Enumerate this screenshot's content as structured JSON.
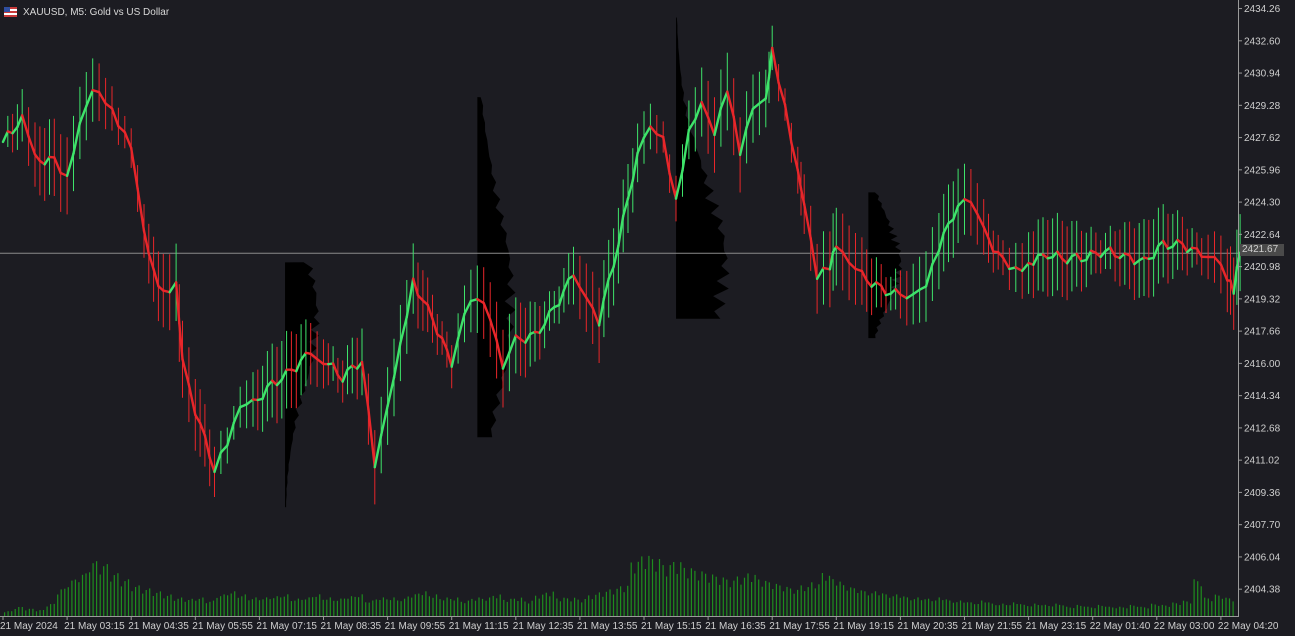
{
  "window": {
    "title": "XAUUSD, M5:  Gold vs US Dollar",
    "title_icon": "us-flag-icon"
  },
  "colors": {
    "background": "#1c1c22",
    "bull": "#3ee36a",
    "bear": "#e8262a",
    "volume": "#1e8c1e",
    "profile": "#000000",
    "grid_line": "#8a8a8a"
  },
  "current_price": "2421.67",
  "chart_data": {
    "type": "line",
    "symbol": "XAUUSD",
    "timeframe": "M5",
    "ylim": [
      2403.0,
      2434.7
    ],
    "y_ticks": [
      "2434.26",
      "2432.60",
      "2430.94",
      "2429.28",
      "2427.62",
      "2425.96",
      "2424.30",
      "2422.64",
      "2420.98",
      "2419.32",
      "2417.66",
      "2416.00",
      "2414.34",
      "2412.68",
      "2411.02",
      "2409.36",
      "2407.70",
      "2406.04",
      "2404.38"
    ],
    "x_ticks": [
      "21 May 2024",
      "21 May 03:15",
      "21 May 04:35",
      "21 May 05:55",
      "21 May 07:15",
      "21 May 08:35",
      "21 May 09:55",
      "21 May 11:15",
      "21 May 12:35",
      "21 May 13:55",
      "21 May 15:15",
      "21 May 16:35",
      "21 May 17:55",
      "21 May 19:15",
      "21 May 20:35",
      "21 May 21:55",
      "21 May 23:15",
      "22 May 01:40",
      "22 May 03:00",
      "22 May 04:20"
    ],
    "x_tick_positions": [
      0,
      1,
      2,
      3,
      4,
      5,
      6,
      7,
      8,
      9,
      10,
      11,
      12,
      13,
      14,
      15,
      16,
      17,
      18,
      19
    ],
    "series": [
      {
        "values": [
          [
            0.0,
            2427.4
          ],
          [
            0.3,
            2428.6
          ],
          [
            0.5,
            2426.5
          ],
          [
            0.8,
            2426.4
          ],
          [
            1.0,
            2425.6
          ],
          [
            1.2,
            2428.5
          ],
          [
            1.4,
            2430.3
          ],
          [
            1.6,
            2429.6
          ],
          [
            1.8,
            2428.3
          ],
          [
            2.0,
            2427.0
          ],
          [
            2.2,
            2422.6
          ],
          [
            2.35,
            2420.6
          ],
          [
            2.5,
            2419.6
          ],
          [
            2.7,
            2420.2
          ],
          [
            2.8,
            2416.4
          ],
          [
            3.0,
            2413.6
          ],
          [
            3.3,
            2410.6
          ],
          [
            3.5,
            2411.8
          ],
          [
            3.7,
            2413.6
          ],
          [
            3.9,
            2413.9
          ],
          [
            4.2,
            2414.9
          ],
          [
            4.5,
            2415.6
          ],
          [
            4.8,
            2416.6
          ],
          [
            5.0,
            2416.2
          ],
          [
            5.3,
            2415.3
          ],
          [
            5.6,
            2416.2
          ],
          [
            5.8,
            2410.6
          ],
          [
            6.0,
            2413.6
          ],
          [
            6.2,
            2416.8
          ],
          [
            6.4,
            2420.2
          ],
          [
            6.7,
            2418.3
          ],
          [
            7.0,
            2416.0
          ],
          [
            7.2,
            2418.8
          ],
          [
            7.4,
            2419.5
          ],
          [
            7.6,
            2418.3
          ],
          [
            7.8,
            2415.6
          ],
          [
            8.0,
            2417.2
          ],
          [
            8.3,
            2417.4
          ],
          [
            8.6,
            2418.8
          ],
          [
            8.9,
            2420.6
          ],
          [
            9.1,
            2419.6
          ],
          [
            9.3,
            2418.2
          ],
          [
            9.6,
            2422.2
          ],
          [
            9.9,
            2426.8
          ],
          [
            10.1,
            2428.0
          ],
          [
            10.3,
            2427.4
          ],
          [
            10.5,
            2424.3
          ],
          [
            10.7,
            2428.0
          ],
          [
            10.9,
            2429.6
          ],
          [
            11.1,
            2428.0
          ],
          [
            11.3,
            2430.2
          ],
          [
            11.5,
            2426.8
          ],
          [
            11.7,
            2429.0
          ],
          [
            11.9,
            2429.4
          ],
          [
            12.0,
            2432.0
          ],
          [
            12.2,
            2429.2
          ],
          [
            12.4,
            2426.0
          ],
          [
            12.5,
            2424.4
          ],
          [
            12.7,
            2420.6
          ],
          [
            12.9,
            2421.0
          ],
          [
            13.0,
            2422.0
          ],
          [
            13.2,
            2421.0
          ],
          [
            13.4,
            2420.5
          ],
          [
            13.7,
            2419.8
          ],
          [
            14.0,
            2419.5
          ],
          [
            14.2,
            2419.7
          ],
          [
            14.4,
            2420.2
          ],
          [
            14.6,
            2422.0
          ],
          [
            14.9,
            2424.2
          ],
          [
            15.1,
            2424.2
          ],
          [
            15.3,
            2422.8
          ],
          [
            15.6,
            2421.2
          ],
          [
            15.8,
            2420.8
          ],
          [
            16.0,
            2421.2
          ],
          [
            16.3,
            2421.6
          ],
          [
            16.6,
            2421.4
          ],
          [
            16.9,
            2421.5
          ],
          [
            17.2,
            2421.8
          ],
          [
            17.5,
            2421.5
          ],
          [
            17.8,
            2421.2
          ],
          [
            18.1,
            2422.1
          ],
          [
            18.4,
            2422.1
          ],
          [
            18.7,
            2421.6
          ],
          [
            18.9,
            2421.7
          ],
          [
            19.1,
            2420.5
          ],
          [
            19.2,
            2419.7
          ],
          [
            19.3,
            2421.7
          ]
        ]
      }
    ],
    "volume": [
      0.08,
      0.15,
      0.12,
      0.1,
      0.2,
      0.45,
      0.6,
      0.7,
      0.9,
      0.85,
      0.7,
      0.6,
      0.5,
      0.45,
      0.4,
      0.35,
      0.3,
      0.28,
      0.3,
      0.25,
      0.35,
      0.4,
      0.35,
      0.3,
      0.3,
      0.32,
      0.35,
      0.28,
      0.3,
      0.35,
      0.3,
      0.28,
      0.32,
      0.35,
      0.25,
      0.3,
      0.3,
      0.28,
      0.35,
      0.4,
      0.35,
      0.3,
      0.3,
      0.25,
      0.3,
      0.3,
      0.35,
      0.28,
      0.3,
      0.25,
      0.35,
      0.4,
      0.3,
      0.3,
      0.28,
      0.35,
      0.4,
      0.45,
      0.5,
      0.9,
      1.0,
      0.95,
      0.85,
      0.9,
      0.8,
      0.75,
      0.7,
      0.65,
      0.6,
      0.65,
      0.7,
      0.6,
      0.55,
      0.5,
      0.45,
      0.5,
      0.55,
      0.7,
      0.6,
      0.5,
      0.45,
      0.4,
      0.4,
      0.35,
      0.35,
      0.3,
      0.3,
      0.28,
      0.3,
      0.25,
      0.25,
      0.22,
      0.25,
      0.2,
      0.2,
      0.22,
      0.18,
      0.2,
      0.18,
      0.2,
      0.15,
      0.18,
      0.15,
      0.18,
      0.15,
      0.15,
      0.18,
      0.15,
      0.2,
      0.18,
      0.22,
      0.25,
      0.6,
      0.3,
      0.35,
      0.3
    ],
    "volume_profiles": [
      {
        "x_from": 4.4,
        "y_top": 2421.2,
        "y_bottom": 2408.6,
        "peak": 2418.4,
        "width": 0.55
      },
      {
        "x_from": 7.4,
        "y_top": 2429.7,
        "y_bottom": 2412.2,
        "peak": 2419.2,
        "width": 0.6
      },
      {
        "x_from": 10.5,
        "y_top": 2433.8,
        "y_bottom": 2418.3,
        "peak": 2421.0,
        "width": 0.85
      },
      {
        "x_from": 13.5,
        "y_top": 2424.8,
        "y_bottom": 2417.3,
        "peak": 2421.2,
        "width": 0.55
      }
    ]
  }
}
